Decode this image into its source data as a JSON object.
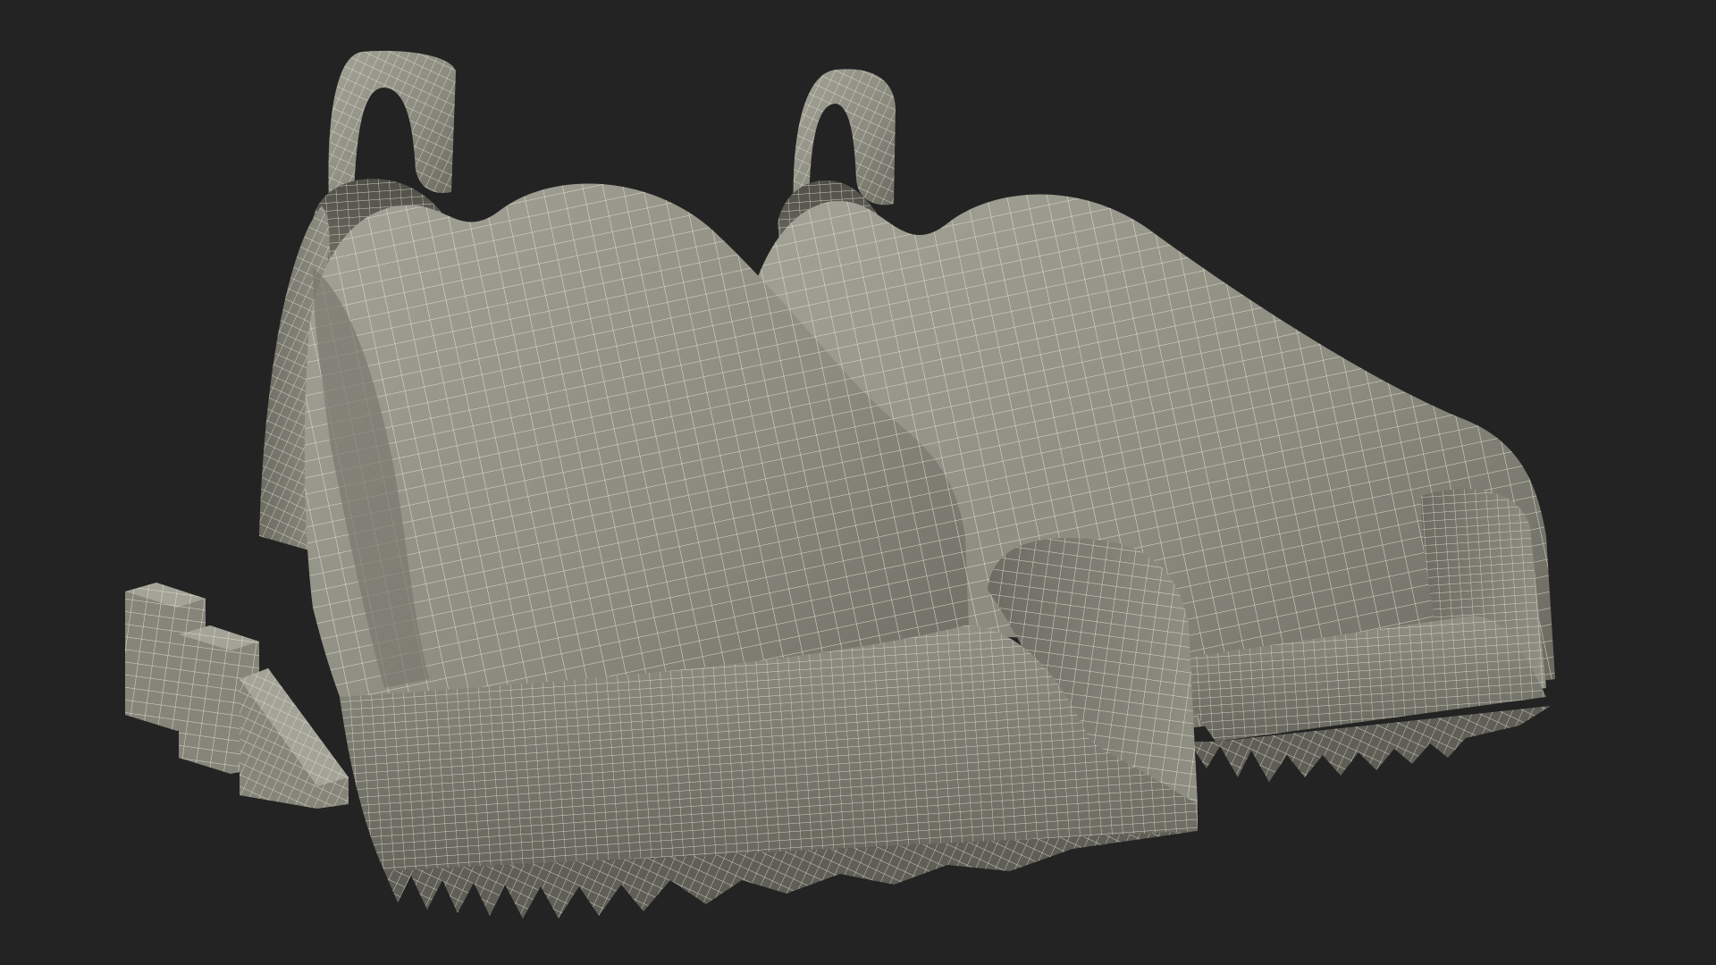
{
  "scene": {
    "background_color": "#232323",
    "subject": "3d-wireframe-sneaker-pair",
    "mesh_fill_color": "#8b8b80",
    "mesh_shadow_color": "#5f5f57",
    "mesh_highlight_color": "#a3a398",
    "wire_color": "#e9e8d8",
    "wire_opacity": 0.85
  }
}
